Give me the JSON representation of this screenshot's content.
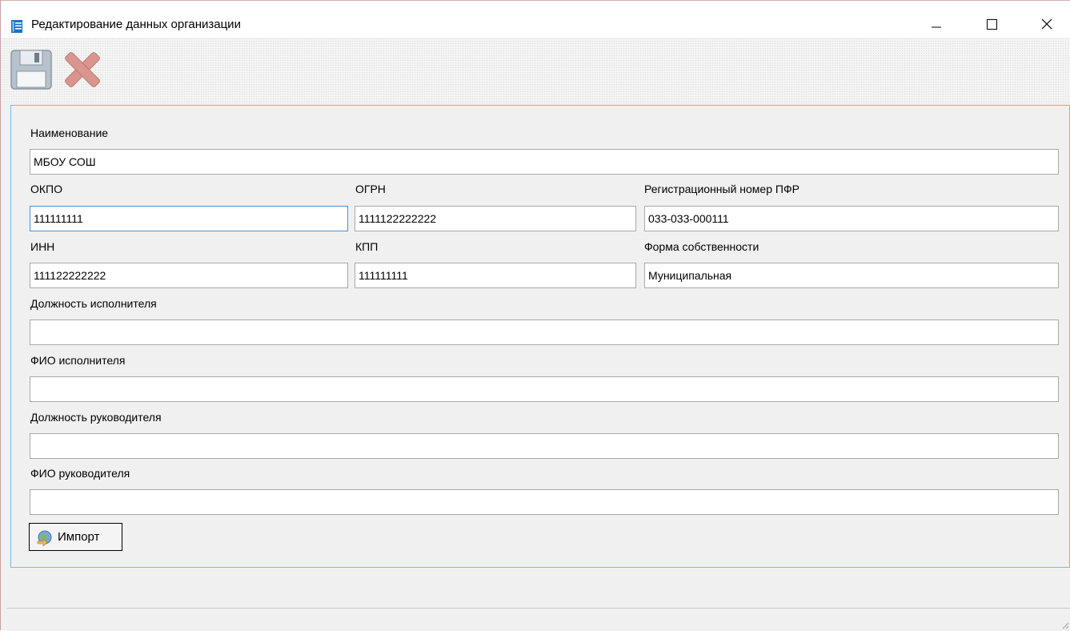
{
  "window": {
    "title": "Редактирование данных организации"
  },
  "colors": {
    "accent": "#1e6fc4",
    "panel_border": "#7fb6e6",
    "focus_border": "#4a90d9"
  },
  "toolbar": {
    "save_icon": "save-icon",
    "cancel_icon": "cancel-icon"
  },
  "form": {
    "name": {
      "label": "Наименование",
      "value": "МБОУ СОШ"
    },
    "okpo": {
      "label": "ОКПО",
      "value": "111111111"
    },
    "ogrn": {
      "label": "ОГРН",
      "value": "1111122222222"
    },
    "pfr": {
      "label": "Регистрационный номер ПФР",
      "value": "033-033-000111"
    },
    "inn": {
      "label": "ИНН",
      "value": "111122222222"
    },
    "kpp": {
      "label": "КПП",
      "value": "111111111"
    },
    "ownership": {
      "label": "Форма собственности",
      "value": "Муниципальная"
    },
    "executor_position": {
      "label": "Должность исполнителя",
      "value": ""
    },
    "executor_name": {
      "label": "ФИО исполнителя",
      "value": ""
    },
    "head_position": {
      "label": "Должность руководителя",
      "value": ""
    },
    "head_name": {
      "label": "ФИО руководителя",
      "value": ""
    }
  },
  "import_button": {
    "label": "Импорт"
  }
}
